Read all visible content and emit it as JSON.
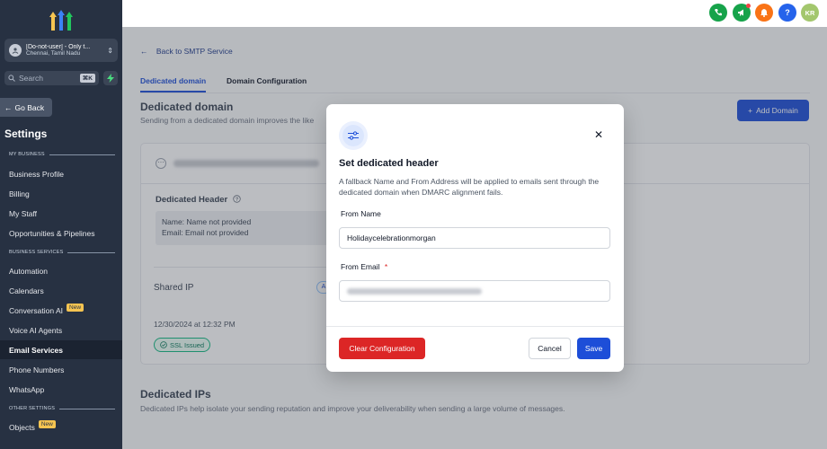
{
  "sidebar": {
    "account": {
      "name": "[Do-not-user] - Only t...",
      "location": "Chennai, Tamil Nadu"
    },
    "search": {
      "placeholder": "Search",
      "shortcut": "⌘K"
    },
    "go_back": "Go Back",
    "settings_title": "Settings",
    "sections": {
      "my_business": "MY BUSINESS",
      "business_services": "BUSINESS SERVICES",
      "other_settings": "OTHER SETTINGS"
    },
    "items": [
      {
        "label": "Business Profile"
      },
      {
        "label": "Billing"
      },
      {
        "label": "My Staff"
      },
      {
        "label": "Opportunities & Pipelines"
      },
      {
        "label": "Automation"
      },
      {
        "label": "Calendars"
      },
      {
        "label": "Conversation AI",
        "badge": "New"
      },
      {
        "label": "Voice AI Agents"
      },
      {
        "label": "Email Services",
        "active": true
      },
      {
        "label": "Phone Numbers"
      },
      {
        "label": "WhatsApp"
      },
      {
        "label": "Objects",
        "badge": "New"
      }
    ]
  },
  "topbar": {
    "icons": [
      "phone-icon",
      "megaphone-icon",
      "bell-icon",
      "help-icon"
    ],
    "avatar_initials": "KR",
    "colors": {
      "phone": "#16a34a",
      "megaphone": "#16a34a",
      "bell": "#f97316",
      "help": "#2563eb",
      "avatar": "#a3c76d"
    }
  },
  "main": {
    "back_link": "Back to SMTP Service",
    "tabs": [
      {
        "label": "Dedicated domain"
      },
      {
        "label": "Domain Configuration"
      }
    ],
    "page_title": "Dedicated domain",
    "page_subtitle": "Sending from a dedicated domain improves the like",
    "add_domain": "Add Domain",
    "card": {
      "dedicated_header_title": "Dedicated Header",
      "name_line": "Name: Name not provided",
      "email_line": "Email: Email not provided",
      "shared_ip": "Shared IP",
      "ip_pill": "A",
      "date": "12/30/2024 at 12:32 PM",
      "ssl": "SSL Issued"
    },
    "ips_title": "Dedicated IPs",
    "ips_subtitle": "Dedicated IPs help isolate your sending reputation and improve your deliverability when sending a large volume of messages."
  },
  "modal": {
    "title": "Set dedicated header",
    "description": "A fallback Name and From Address will be applied to emails sent through the dedicated domain when DMARC alignment fails.",
    "from_name_label": "From Name",
    "from_name_value": "Holidaycelebrationmorgan",
    "from_email_label": "From Email",
    "required_mark": "*",
    "clear_button": "Clear Configuration",
    "cancel_button": "Cancel",
    "save_button": "Save"
  }
}
